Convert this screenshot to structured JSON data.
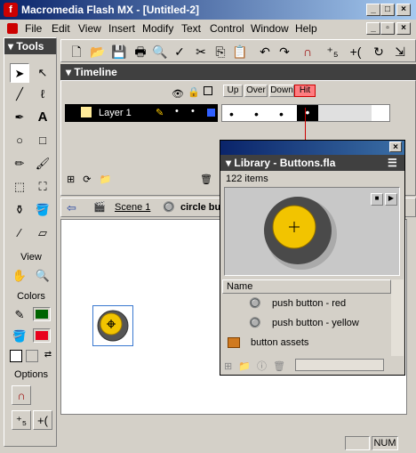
{
  "window": {
    "title": "Macromedia Flash MX - [Untitled-2]"
  },
  "menu": [
    "File",
    "Edit",
    "View",
    "Insert",
    "Modify",
    "Text",
    "Control",
    "Window",
    "Help"
  ],
  "tools": {
    "title": "Tools",
    "view_label": "View",
    "colors_label": "Colors",
    "options_label": "Options"
  },
  "timeline": {
    "title": "Timeline",
    "layer_name": "Layer 1",
    "frame_labels": [
      "Up",
      "Over",
      "Down",
      "Hit"
    ]
  },
  "stage": {
    "scene_label": "Scene 1",
    "symbol_label": "circle but"
  },
  "library": {
    "title": "Library - Buttons.fla",
    "item_count": "122 items",
    "column_name": "Name",
    "items": [
      {
        "label": "push button - red",
        "icon": "button-symbol-icon"
      },
      {
        "label": "push button - yellow",
        "icon": "button-symbol-icon"
      },
      {
        "label": "button assets",
        "icon": "folder-icon"
      }
    ]
  },
  "status": {
    "num": "NUM"
  },
  "colors": {
    "stroke": "#006400",
    "fill": "#e8001c",
    "accent": "#ff7c80"
  }
}
